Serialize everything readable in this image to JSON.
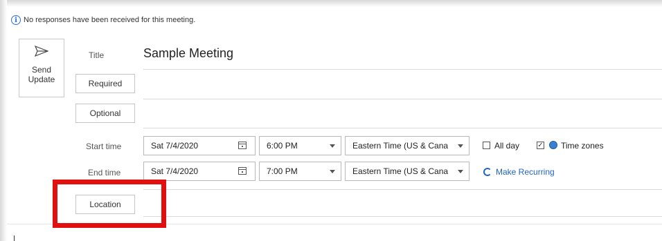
{
  "info": {
    "message": "No responses have been received for this meeting."
  },
  "send": {
    "label_line1": "Send",
    "label_line2": "Update"
  },
  "fields": {
    "title_label": "Title",
    "title_value": "Sample Meeting",
    "required_label": "Required",
    "optional_label": "Optional",
    "start_label": "Start time",
    "end_label": "End time",
    "location_label": "Location"
  },
  "start": {
    "date": "Sat 7/4/2020",
    "time": "6:00 PM",
    "timezone": "Eastern Time (US & Cana"
  },
  "end": {
    "date": "Sat 7/4/2020",
    "time": "7:00 PM",
    "timezone": "Eastern Time (US & Cana"
  },
  "options": {
    "all_day_label": "All day",
    "all_day_checked": false,
    "time_zones_label": "Time zones",
    "time_zones_checked": true,
    "recurring_label": "Make Recurring"
  },
  "colors": {
    "highlight": "#e01010",
    "link": "#1f64c4",
    "info": "#2b6ec9"
  },
  "icons": [
    "info-icon",
    "send-icon",
    "calendar-icon",
    "globe-icon",
    "recurring-icon",
    "chevron-down-icon"
  ]
}
